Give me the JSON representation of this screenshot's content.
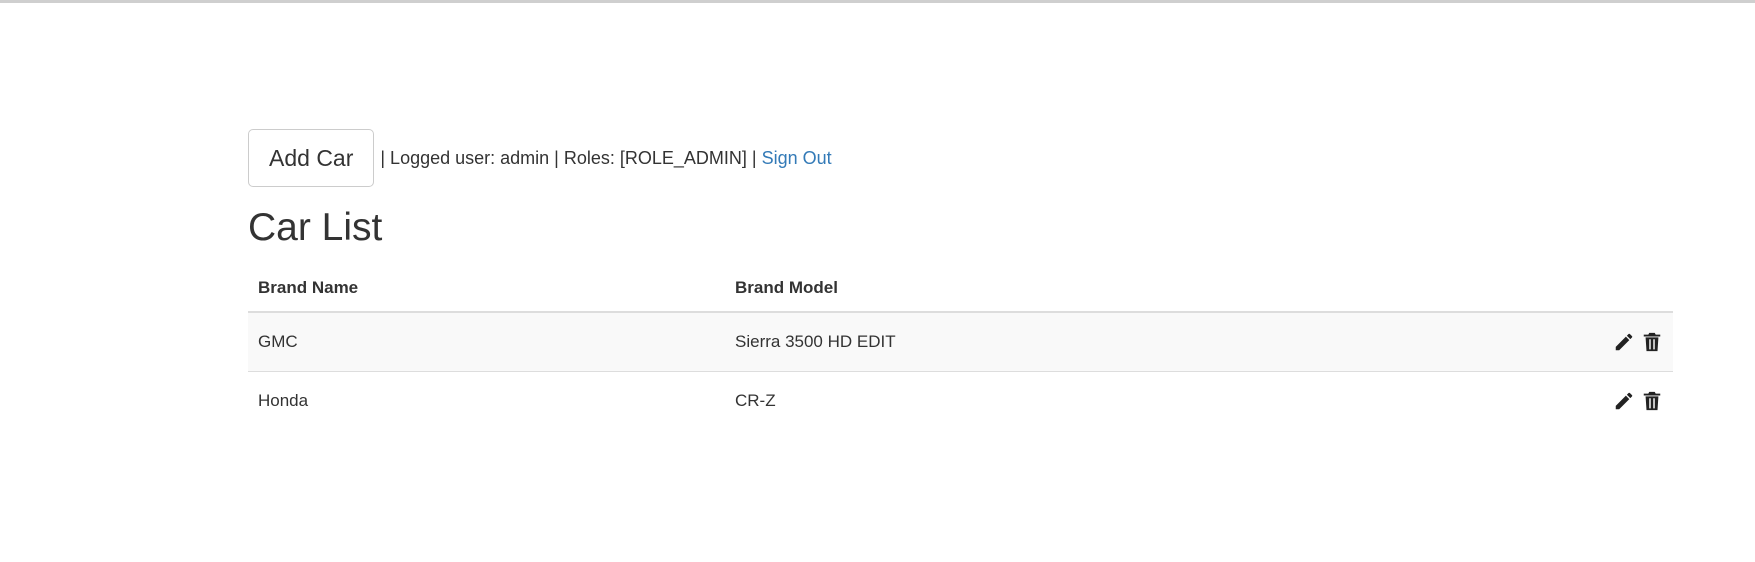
{
  "header": {
    "add_button_label": "Add Car",
    "user_info": "| Logged user: admin | Roles: [ROLE_ADMIN] |",
    "sign_out_label": "Sign Out"
  },
  "page": {
    "title": "Car List"
  },
  "table": {
    "columns": [
      "Brand Name",
      "Brand Model",
      ""
    ],
    "rows": [
      {
        "brand_name": "GMC",
        "brand_model": "Sierra 3500 HD EDIT"
      },
      {
        "brand_name": "Honda",
        "brand_model": "CR-Z"
      }
    ],
    "row_action_icons": [
      "pencil-icon",
      "trash-icon"
    ]
  },
  "colors": {
    "link": "#337ab7",
    "text": "#333333",
    "stripe": "#f9f9f9",
    "border": "#dddddd"
  }
}
